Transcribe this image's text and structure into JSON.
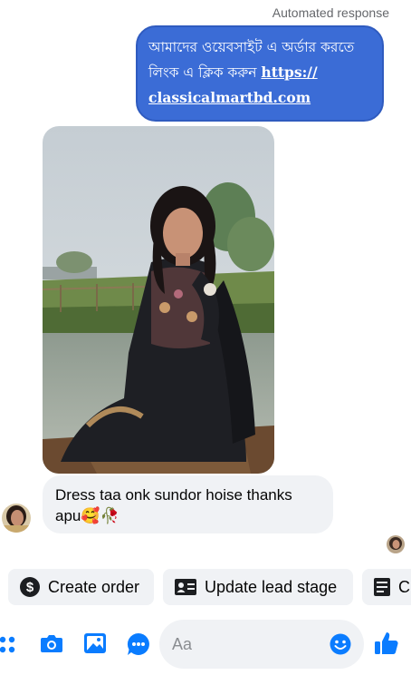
{
  "status": {
    "automated_label": "Automated response"
  },
  "outgoing_message": {
    "text": "আমাদের ওয়েবসাইট এ অর্ডার করতে লিংক এ ক্লিক করুন",
    "link_part1": "https://",
    "link_part2": "classicalmartbd.com"
  },
  "incoming_message": {
    "text": "Dress taa onk sundor hoise thanks apu🥰🥀"
  },
  "quick_actions": [
    {
      "label": "Create order",
      "icon": "dollar-circle-icon"
    },
    {
      "label": "Update lead stage",
      "icon": "contact-card-icon"
    },
    {
      "label": "C",
      "icon": "invoice-icon"
    }
  ],
  "composer": {
    "placeholder": "Aa"
  },
  "colors": {
    "accent": "#0a7cff",
    "outgoing_bubble": "#3b6cd6",
    "incoming_bubble": "#f0f2f5"
  }
}
